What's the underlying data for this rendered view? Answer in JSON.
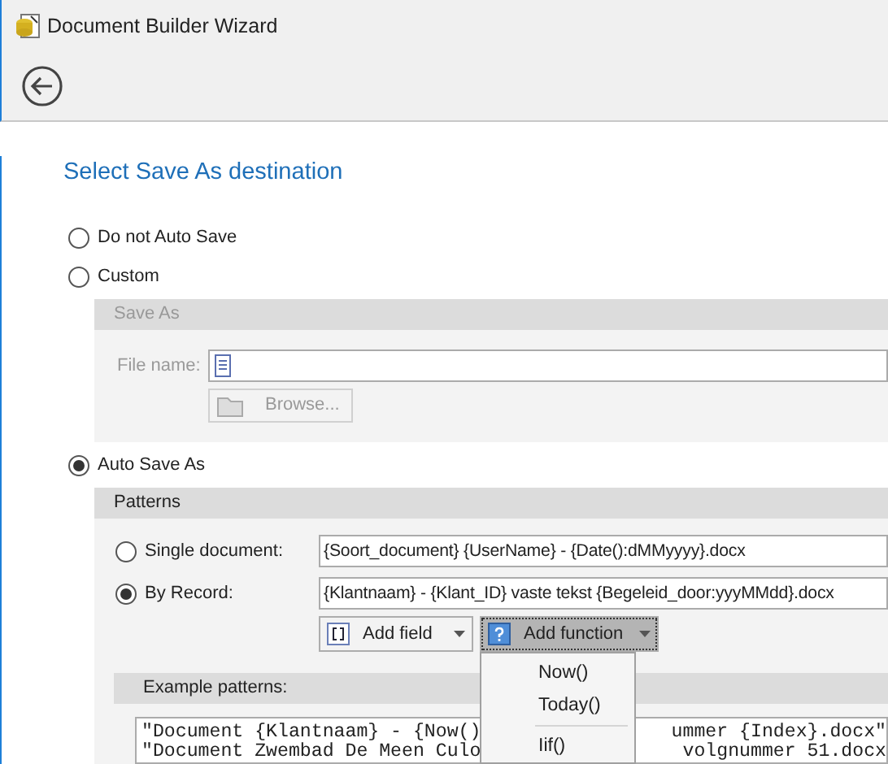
{
  "window": {
    "title": "Document Builder Wizard"
  },
  "heading": "Select Save As destination",
  "destinations": [
    {
      "label": "Do not Auto Save",
      "selected": false
    },
    {
      "label": "Custom",
      "selected": false,
      "panel": {
        "kind": "save_as",
        "title": "Save As",
        "disabled": true,
        "file_label": "File name:",
        "browse_button": "Browse..."
      }
    },
    {
      "label": "Auto Save As",
      "selected": true,
      "panel": {
        "kind": "patterns",
        "title": "Patterns",
        "modes": [
          {
            "label": "Single document:",
            "selected": false,
            "value": "{Soort_document} {UserName} - {Date():dMMyyyy}.docx"
          },
          {
            "label": "By Record:",
            "selected": true,
            "value": "{Klantnaam} - {Klant_ID} vaste tekst {Begeleid_door:yyyMMdd}.docx"
          }
        ],
        "buttons": [
          {
            "label": "Add field",
            "kind": "field",
            "pressed": false
          },
          {
            "label": "Add function",
            "kind": "function",
            "pressed": true
          }
        ],
        "menu": [
          {
            "label": "Now()",
            "separator_before": false
          },
          {
            "label": "Today()",
            "separator_before": false
          },
          {
            "label": "Iif()",
            "separator_before": true
          }
        ],
        "examples_title": "Example patterns:",
        "example_lines": [
          {
            "left": "\"Document {Klantnaam} - {Now()",
            "right": "ummer {Index}.docx\""
          },
          {
            "left": "\"Document Zwembad De Meen Culo",
            "right": "volgnummer 51.docx"
          }
        ]
      }
    }
  ]
}
